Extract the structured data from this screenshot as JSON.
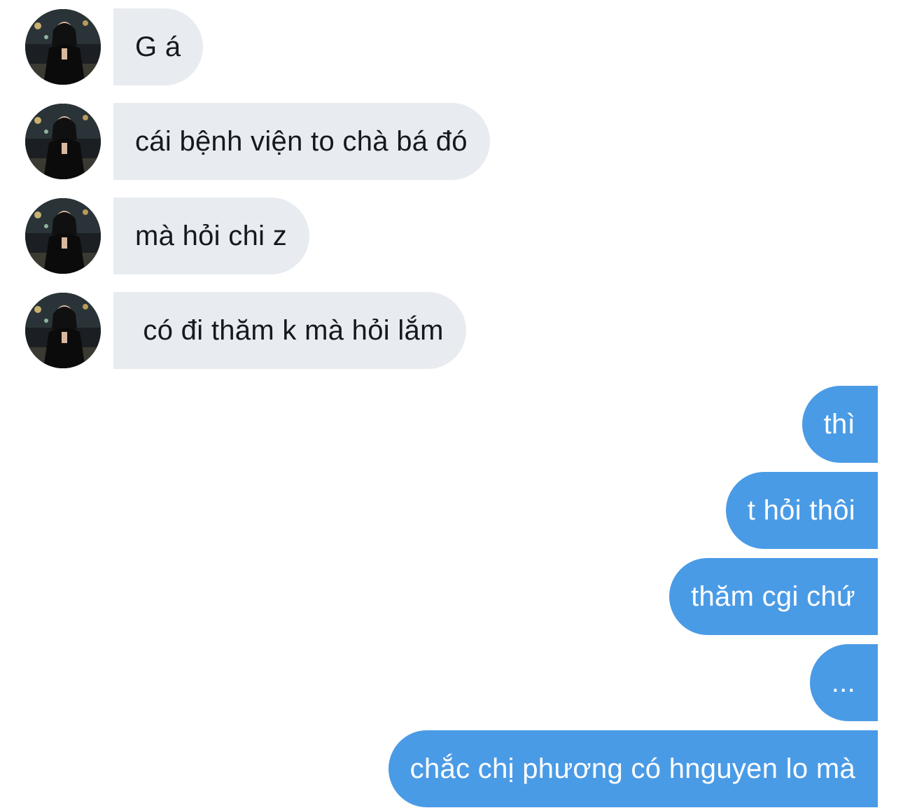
{
  "conversation": {
    "contact_avatar_icon": "profile-photo-icon",
    "colors": {
      "incoming_bubble": "#e8ebef",
      "incoming_text": "#15181c",
      "outgoing_bubble": "#4a9be6",
      "outgoing_text": "#ffffff",
      "background": "#ffffff"
    },
    "incoming": [
      {
        "text": "G á"
      },
      {
        "text": "cái bệnh viện to chà bá đó"
      },
      {
        "text": "mà hỏi chi z"
      },
      {
        "text": " có đi thăm k mà hỏi lắm"
      }
    ],
    "outgoing": [
      {
        "text": "thì"
      },
      {
        "text": "t hỏi thôi"
      },
      {
        "text": "thăm cgi chứ"
      },
      {
        "text": "..."
      },
      {
        "text": "chắc chị phương có hnguyen lo mà"
      }
    ]
  }
}
